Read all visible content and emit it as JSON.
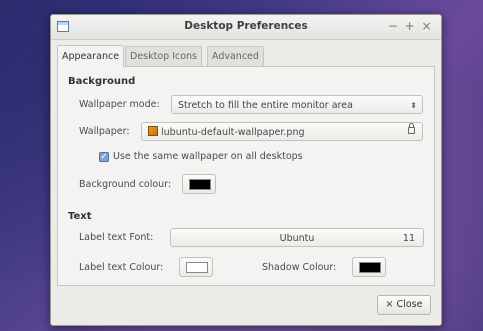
{
  "window": {
    "title": "Desktop Preferences",
    "controls": [
      "−",
      "+",
      "×"
    ]
  },
  "tabs": [
    {
      "label": "Appearance",
      "active": true
    },
    {
      "label": "Desktop Icons",
      "active": false
    },
    {
      "label": "Advanced",
      "active": false
    }
  ],
  "background": {
    "section_title": "Background",
    "mode_label": "Wallpaper mode:",
    "mode_value": "Stretch to fill the entire monitor area",
    "wallpaper_label": "Wallpaper:",
    "wallpaper_value": "lubuntu-default-wallpaper.png",
    "same_wallpaper_label": "Use the same wallpaper on all desktops",
    "same_wallpaper_checked": true,
    "colour_label": "Background colour:",
    "colour_value": "#000000"
  },
  "text": {
    "section_title": "Text",
    "font_label": "Label text Font:",
    "font_name": "Ubuntu",
    "font_size": "11",
    "label_colour_label": "Label text Colour:",
    "label_colour_value": "#ffffff",
    "shadow_colour_label": "Shadow Colour:",
    "shadow_colour_value": "#000000"
  },
  "footer": {
    "close_label": "Close",
    "close_icon": "×"
  }
}
